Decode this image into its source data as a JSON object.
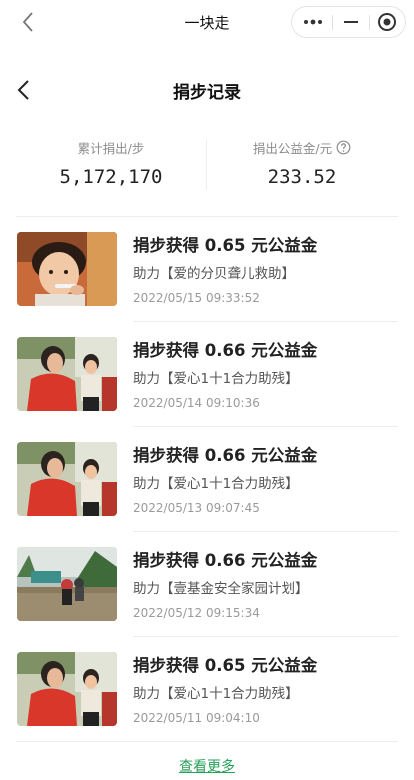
{
  "topbar": {
    "title": "一块走",
    "back_icon": "chevron-left-icon",
    "menu_icon": "more-dots-icon",
    "minimize_icon": "minimize-icon",
    "close_icon": "target-circle-icon"
  },
  "header": {
    "title": "捐步记录",
    "back_icon": "chevron-left-icon"
  },
  "stats": {
    "steps_label": "累计捐出/步",
    "steps_value": "5,172,170",
    "fund_label": "捐出公益金/元",
    "fund_value": "233.52",
    "help_icon": "question-circle-icon"
  },
  "records": [
    {
      "title": "捐步获得 0.65 元公益金",
      "project": "助力【爱的分贝聋儿救助】",
      "date": "2022/05/15 09:33:52",
      "thumb": "child-photo"
    },
    {
      "title": "捐步获得 0.66 元公益金",
      "project": "助力【爱心1十1合力助残】",
      "date": "2022/05/14 09:10:36",
      "thumb": "family-photo"
    },
    {
      "title": "捐步获得 0.66 元公益金",
      "project": "助力【爱心1十1合力助残】",
      "date": "2022/05/13 09:07:45",
      "thumb": "family-photo"
    },
    {
      "title": "捐步获得 0.66 元公益金",
      "project": "助力【壹基金安全家园计划】",
      "date": "2022/05/12 09:15:34",
      "thumb": "flood-photo"
    },
    {
      "title": "捐步获得 0.65 元公益金",
      "project": "助力【爱心1十1合力助残】",
      "date": "2022/05/11 09:04:10",
      "thumb": "family-photo"
    }
  ],
  "more_link": "查看更多",
  "colors": {
    "accent_green": "#27a05a",
    "muted_text": "#8c8c8c",
    "divider": "#eeeeee"
  }
}
